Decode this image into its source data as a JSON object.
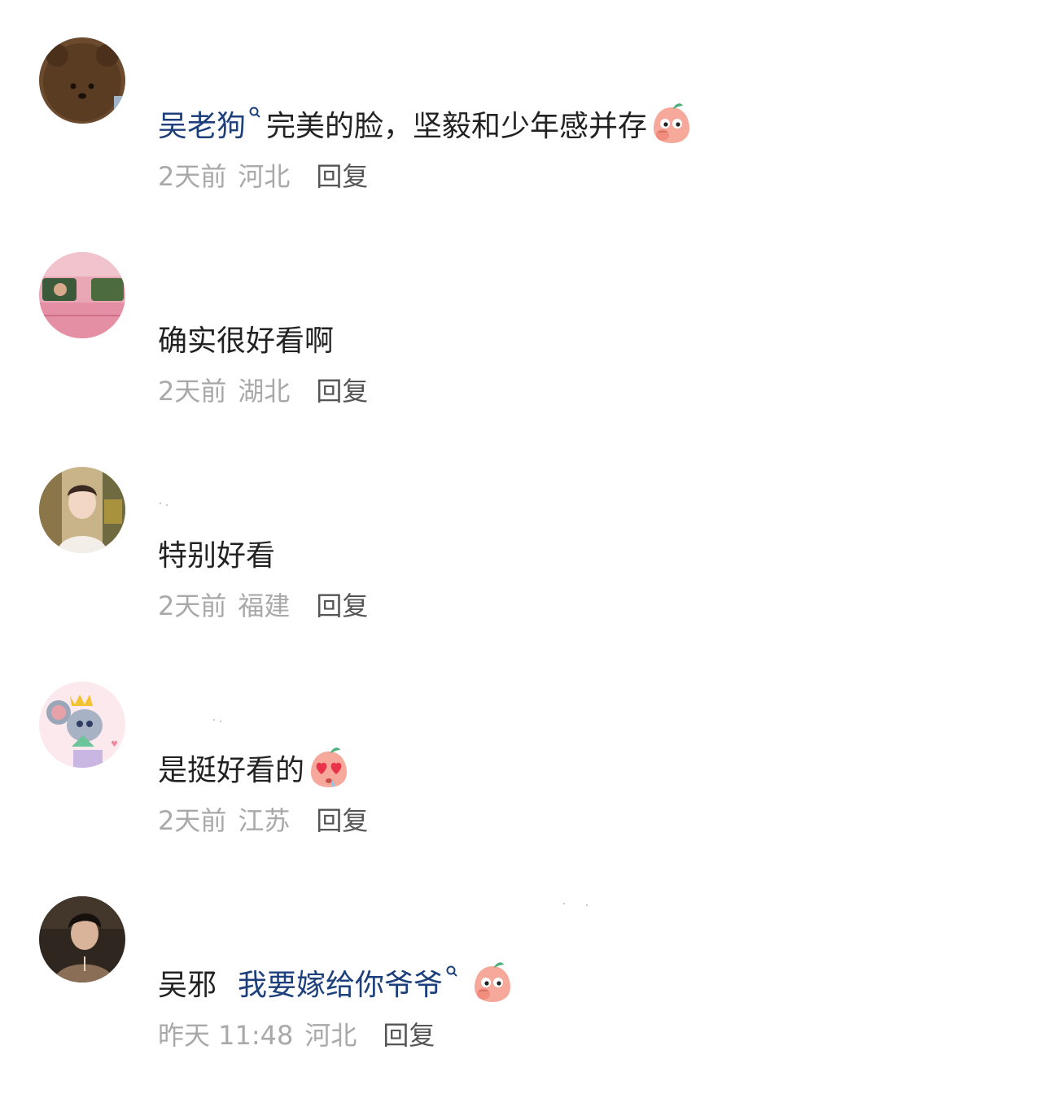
{
  "comments": [
    {
      "name_visible": "",
      "body_prefix": "",
      "mention": "吴老狗",
      "text": "完美的脸，坚毅和少年感并存",
      "emoji": "covering-mouth-peach-emoji",
      "time": "2天前",
      "region": "河北",
      "reply_label": "回复",
      "avatar": "brown-bear-avatar"
    },
    {
      "name_visible": "",
      "body_prefix": "",
      "mention": "",
      "text": "确实很好看啊",
      "emoji": "",
      "time": "2天前",
      "region": "湖北",
      "reply_label": "回复",
      "avatar": "pink-car-avatar"
    },
    {
      "name_visible": "",
      "body_prefix": "",
      "mention": "",
      "text": "特别好看",
      "emoji": "",
      "time": "2天前",
      "region": "福建",
      "reply_label": "回复",
      "avatar": "young-man-avatar"
    },
    {
      "name_visible": "",
      "body_prefix": "",
      "mention": "",
      "text": "是挺好看的",
      "emoji": "heart-eyes-peach-emoji",
      "time": "2天前",
      "region": "江苏",
      "reply_label": "回复",
      "avatar": "cartoon-mouse-avatar"
    },
    {
      "name_visible": "",
      "body_prefix": "吴邪",
      "mention": "我要嫁给你爷爷",
      "text": "",
      "emoji": "covering-mouth-peach-emoji",
      "time": "昨天 11:48",
      "region": "河北",
      "reply_label": "回复",
      "avatar": "dark-haired-man-avatar"
    }
  ],
  "colors": {
    "mention": "#1d3f7c",
    "body_text": "#222222",
    "meta_text": "#a9a9a9",
    "reply_text": "#555555",
    "emoji_peach": "#f6a99b"
  }
}
